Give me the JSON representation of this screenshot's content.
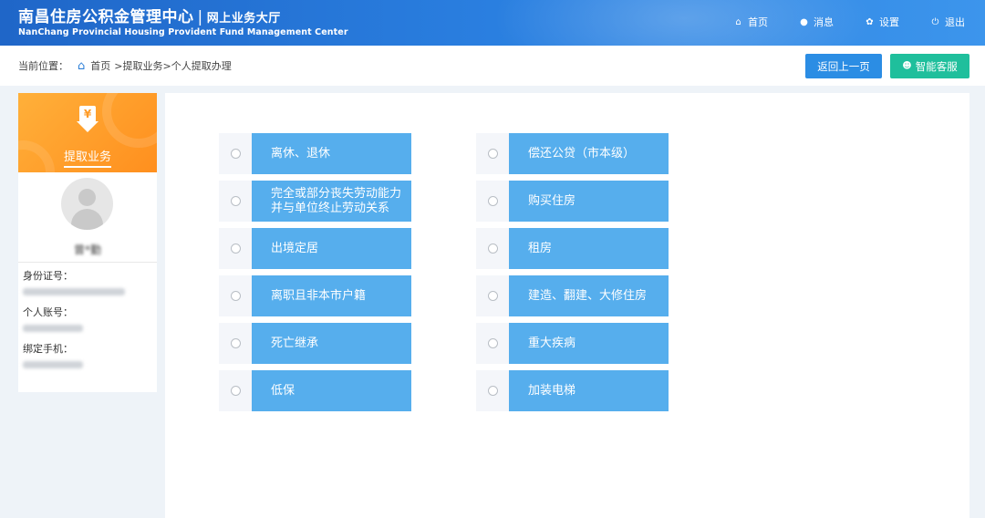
{
  "header": {
    "title": "南昌住房公积金管理中心",
    "separator": "|",
    "subtitle": "网上业务大厅",
    "title_en": "NanChang Provincial Housing Provident Fund Management Center",
    "nav": [
      {
        "label": "首页",
        "icon": "home-icon"
      },
      {
        "label": "消息",
        "icon": "message-icon"
      },
      {
        "label": "设置",
        "icon": "gear-icon"
      },
      {
        "label": "退出",
        "icon": "power-icon"
      }
    ]
  },
  "breadcrumb": {
    "prefix": "当前位置：",
    "home": "首页",
    "path": ">提取业务>个人提取办理"
  },
  "actions": {
    "back_label": "返回上一页",
    "service_label": "智能客服"
  },
  "sidebar": {
    "section_title": "提取业务",
    "section_icon": "yen-download-icon",
    "user_name": "曾*勤",
    "id_label": "身份证号：",
    "account_label": "个人账号：",
    "phone_label": "绑定手机："
  },
  "options": {
    "left": [
      "离休、退休",
      "完全或部分丧失劳动能力并与单位终止劳动关系",
      "出境定居",
      "离职且非本市户籍",
      "死亡继承",
      "低保"
    ],
    "right": [
      "偿还公贷（市本级）",
      "购买住房",
      "租房",
      "建造、翻建、大修住房",
      "重大疾病",
      "加装电梯"
    ]
  },
  "colors": {
    "header_blue": "#2a7fe0",
    "option_blue": "#56aeed",
    "accent_orange": "#ff9b26",
    "service_green": "#1fbf9c"
  }
}
